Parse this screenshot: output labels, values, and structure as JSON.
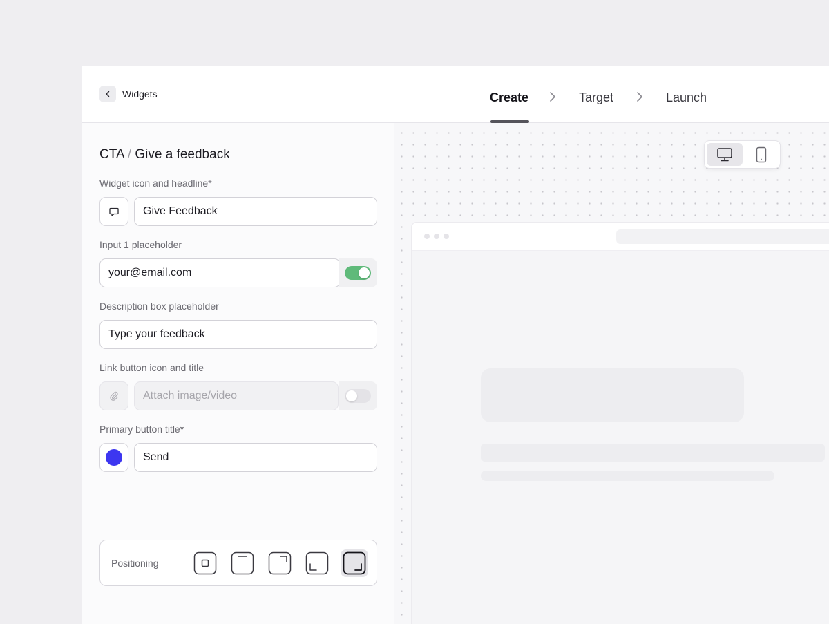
{
  "topbar": {
    "back_label": "Widgets",
    "steps": [
      {
        "label": "Create",
        "active": true
      },
      {
        "label": "Target",
        "active": false
      },
      {
        "label": "Launch",
        "active": false
      }
    ]
  },
  "form": {
    "title_prefix": "CTA",
    "title_separator": "/",
    "title_main": "Give a feedback",
    "widget_icon": {
      "label": "Widget icon and headline*",
      "icon": "chat-bubble-icon",
      "value": "Give Feedback"
    },
    "input1": {
      "label": "Input 1 placeholder",
      "value": "your@email.com",
      "enabled": true
    },
    "description": {
      "label": "Description box placeholder",
      "value": "Type your feedback"
    },
    "link_button": {
      "label": "Link button icon and title",
      "icon": "paperclip-icon",
      "placeholder": "Attach image/video",
      "enabled": false
    },
    "primary_button": {
      "label": "Primary button title*",
      "color": "#3d36f0",
      "value": "Send"
    },
    "positioning": {
      "label": "Positioning",
      "options": [
        "center",
        "top",
        "top-right",
        "bottom-left",
        "bottom-right"
      ],
      "selected": "bottom-right"
    }
  },
  "preview": {
    "device_options": [
      "desktop-icon",
      "mobile-icon"
    ],
    "selected_device": "desktop"
  },
  "colors": {
    "toggle_on": "#5fba7a",
    "accent": "#3d36f0"
  }
}
